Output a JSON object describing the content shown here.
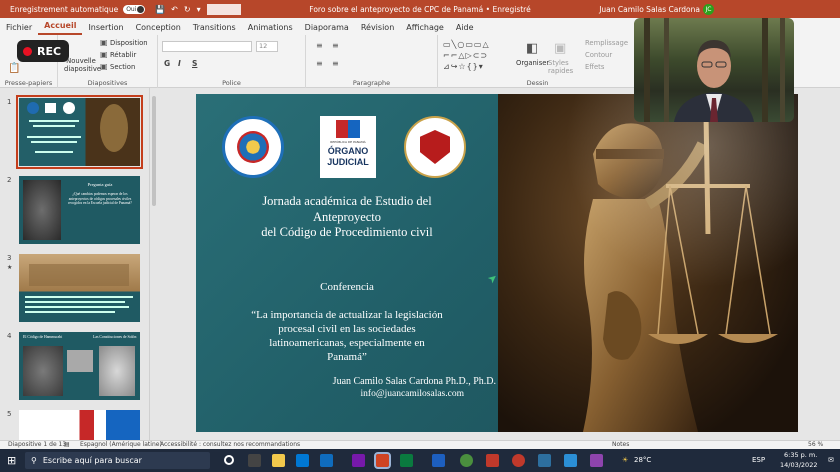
{
  "titlebar": {
    "autosave_label": "Enregistrement automatique",
    "toggle_label": "Oui",
    "doc_title": "Foro sobre el anteproyecto de CPC de Panamá • Enregistré",
    "user_name": "Juan Camilo Salas Cardona",
    "avatar_initial": "JC",
    "accent_color": "#b7472a"
  },
  "menu": {
    "tabs": [
      "Fichier",
      "Accueil",
      "Insertion",
      "Conception",
      "Transitions",
      "Animations",
      "Diaporama",
      "Révision",
      "Affichage",
      "Aide"
    ],
    "active": "Accueil"
  },
  "ribbon": {
    "clipboard_label": "Presse-papiers",
    "new_slide_label": "Nouvelle diapositive",
    "layout_label": "Disposition",
    "reset_label": "Rétablir",
    "section_label": "Section",
    "slides_group_label": "Diapositives",
    "font_group_label": "Police",
    "font_size": "12",
    "paragraph_group_label": "Paragraphe",
    "drawing_group_label": "Dessin",
    "arrange_label": "Organiser",
    "quick_styles_label": "Styles rapides",
    "fill_label": "Remplissage",
    "outline_label": "Contour",
    "effects_label": "Effets",
    "bold": "G",
    "italic": "I",
    "underline": "S"
  },
  "recording": {
    "label": "REC",
    "dot_color": "#e81123"
  },
  "slide_panel": {
    "numbers": [
      "1",
      "2",
      "3",
      "4",
      "5"
    ],
    "star_marker": "★",
    "thumb2_title": "Pregunta guía",
    "thumb2_text": "¿Qué cambios podemos esperar de los anteproyectos de códigos procesales civiles recogidos en la Escuela judicial de Panamá?",
    "thumb4_left": "El Código de Hammurabi",
    "thumb4_right": "Las Constituciones de Solón"
  },
  "slide": {
    "heading_line1": "Jornada académica de Estudio del",
    "heading_line2": "Anteproyecto",
    "heading_line3": "del Código de Procedimiento civil",
    "conference_label": "Conferencia",
    "quote_line1": "“La importancia de actualizar la legislación",
    "quote_line2": "procesal civil en las sociedades",
    "quote_line3": "latinoamericanas, especialmente en",
    "quote_line4": "Panamá”",
    "author": "Juan Camilo Salas Cardona Ph.D., Ph.D.",
    "email": "info@juancamilosalas.com",
    "organo_line1": "REPÚBLICA DE PANAMÁ",
    "organo_line2": "ÓRGANO",
    "organo_line3": "JUDICIAL",
    "background_color": "#215f68"
  },
  "statusbar": {
    "slide_info": "Diapositive 1 de 13",
    "language": "Espagnol (Amérique latine)",
    "accessibility": "Accessibilité : consultez nos recommandations",
    "notes_label": "Notes",
    "zoom": "56 %"
  },
  "taskbar": {
    "search_placeholder": "Escribe aquí para buscar",
    "temperature": "28°C",
    "time": "6:35 p. m.",
    "date": "14/03/2022",
    "language": "ESP"
  }
}
